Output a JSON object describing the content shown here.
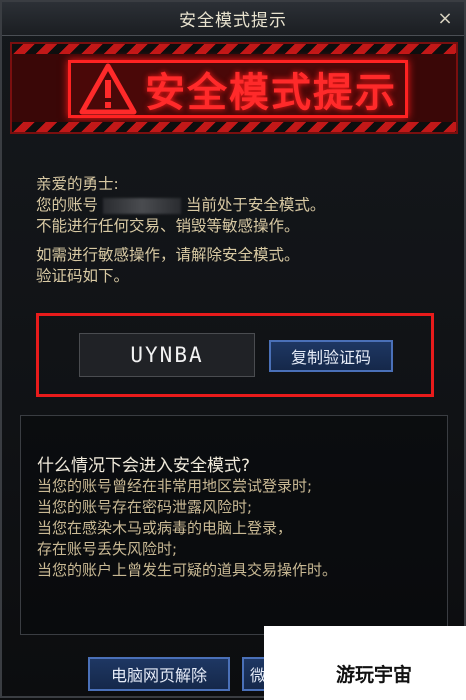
{
  "window": {
    "title": "安全模式提示",
    "close_glyph": "×"
  },
  "banner": {
    "title": "安全模式提示",
    "icon": "warning-triangle-icon"
  },
  "message": {
    "greeting": "亲爱的勇士:",
    "line1_before": "您的账号",
    "line1_after": "当前处于安全模式。",
    "line2": "不能进行任何交易、销毁等敏感操作。",
    "line3": "如需进行敏感操作，请解除安全模式。",
    "line4": "验证码如下。"
  },
  "verification": {
    "code": "UYNBA",
    "copy_label": "复制验证码"
  },
  "info": {
    "title": "什么情况下会进入安全模式?",
    "items": [
      "当您的账号曾经在非常用地区尝试登录时;",
      "当您的账号存在密码泄露风险时;",
      "当您在感染木马或病毒的电脑上登录，",
      "存在账号丢失风险时;",
      "当您的账户上曾发生可疑的道具交易操作时。"
    ]
  },
  "buttons": {
    "web_unlock": "电脑网页解除",
    "second_partial": "微"
  },
  "watermark": {
    "text": "游玩宇宙"
  },
  "colors": {
    "accent_red": "#ff2222",
    "button_blue": "#1e3763",
    "text_gold": "#d8c9a3"
  }
}
